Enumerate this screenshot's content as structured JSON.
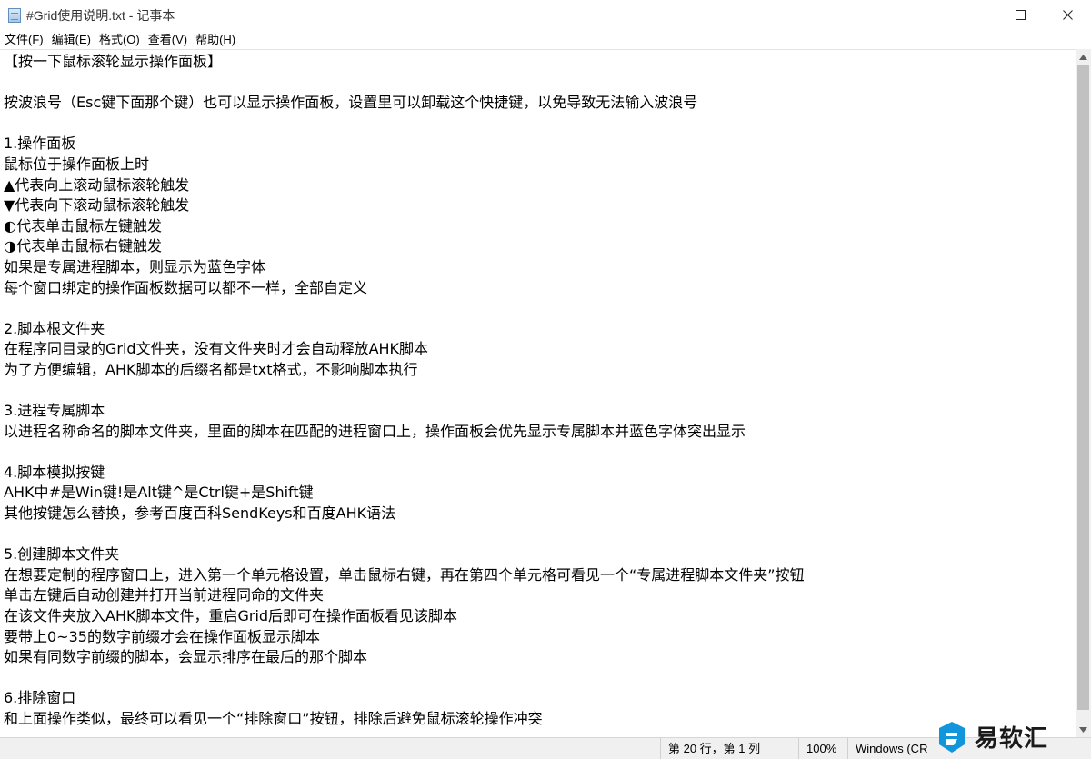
{
  "window": {
    "title": "#Grid使用说明.txt - 记事本",
    "controls": [
      "minimize",
      "maximize",
      "close"
    ]
  },
  "menu": {
    "items": [
      "文件(F)",
      "编辑(E)",
      "格式(O)",
      "查看(V)",
      "帮助(H)"
    ]
  },
  "editor": {
    "lines": [
      "【按一下鼠标滚轮显示操作面板】",
      "",
      "按波浪号（Esc键下面那个键）也可以显示操作面板，设置里可以卸载这个快捷键，以免导致无法输入波浪号",
      "",
      "1.操作面板",
      "鼠标位于操作面板上时",
      "▲代表向上滚动鼠标滚轮触发",
      "▼代表向下滚动鼠标滚轮触发",
      "◐代表单击鼠标左键触发",
      "◑代表单击鼠标右键触发",
      "如果是专属进程脚本，则显示为蓝色字体",
      "每个窗口绑定的操作面板数据可以都不一样，全部自定义",
      "",
      "2.脚本根文件夹",
      "在程序同目录的Grid文件夹，没有文件夹时才会自动释放AHK脚本",
      "为了方便编辑，AHK脚本的后缀名都是txt格式，不影响脚本执行",
      "",
      "3.进程专属脚本",
      "以进程名称命名的脚本文件夹，里面的脚本在匹配的进程窗口上，操作面板会优先显示专属脚本并蓝色字体突出显示",
      "",
      "4.脚本模拟按键",
      "AHK中#是Win键!是Alt键^是Ctrl键+是Shift键",
      "其他按键怎么替换，参考百度百科SendKeys和百度AHK语法",
      "",
      "5.创建脚本文件夹",
      "在想要定制的程序窗口上，进入第一个单元格设置，单击鼠标右键，再在第四个单元格可看见一个“专属进程脚本文件夹”按钮",
      "单击左键后自动创建并打开当前进程同命的文件夹",
      "在该文件夹放入AHK脚本文件，重启Grid后即可在操作面板看见该脚本",
      "要带上0~35的数字前缀才会在操作面板显示脚本",
      "如果有同数字前缀的脚本，会显示排序在最后的那个脚本",
      "",
      "6.排除窗口",
      "和上面操作类似，最终可以看见一个“排除窗口”按钮，排除后避免鼠标滚轮操作冲突"
    ]
  },
  "status": {
    "position": "第 20 行，第 1 列",
    "zoom": "100%",
    "line_ending": "Windows (CR"
  },
  "watermark": {
    "text": "易软汇"
  }
}
